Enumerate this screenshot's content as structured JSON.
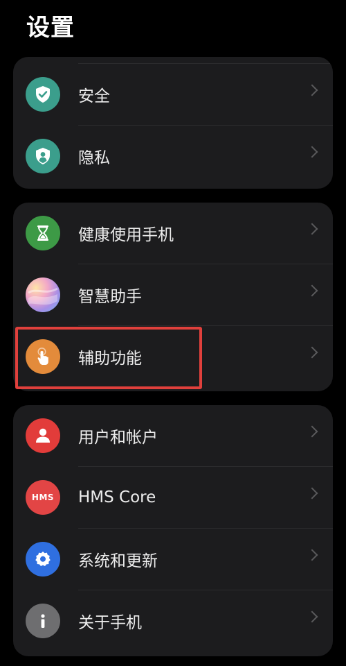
{
  "header": {
    "title": "设置"
  },
  "groups": [
    {
      "items": [
        {
          "label": "安全",
          "icon": "shield-check-icon",
          "color": "#3b9e8c"
        },
        {
          "label": "隐私",
          "icon": "privacy-shield-user-icon",
          "color": "#3b9e8c"
        }
      ]
    },
    {
      "items": [
        {
          "label": "健康使用手机",
          "icon": "hourglass-icon",
          "color": "#3d9a46"
        },
        {
          "label": "智慧助手",
          "icon": "assistant-orb-icon",
          "color": "#b7a3e6"
        },
        {
          "label": "辅助功能",
          "icon": "hand-pointer-icon",
          "color": "#e38b3b"
        }
      ]
    },
    {
      "items": [
        {
          "label": "用户和帐户",
          "icon": "user-icon",
          "color": "#e23c3a"
        },
        {
          "label": "HMS Core",
          "icon": "hms-core-icon",
          "icon_text": "HMS",
          "color": "#e24545"
        },
        {
          "label": "系统和更新",
          "icon": "gear-icon",
          "color": "#2f6fe0"
        },
        {
          "label": "关于手机",
          "icon": "info-icon",
          "color": "#6e6e70"
        }
      ]
    }
  ],
  "highlight": {
    "target": "辅助功能",
    "color": "#e0403c"
  }
}
